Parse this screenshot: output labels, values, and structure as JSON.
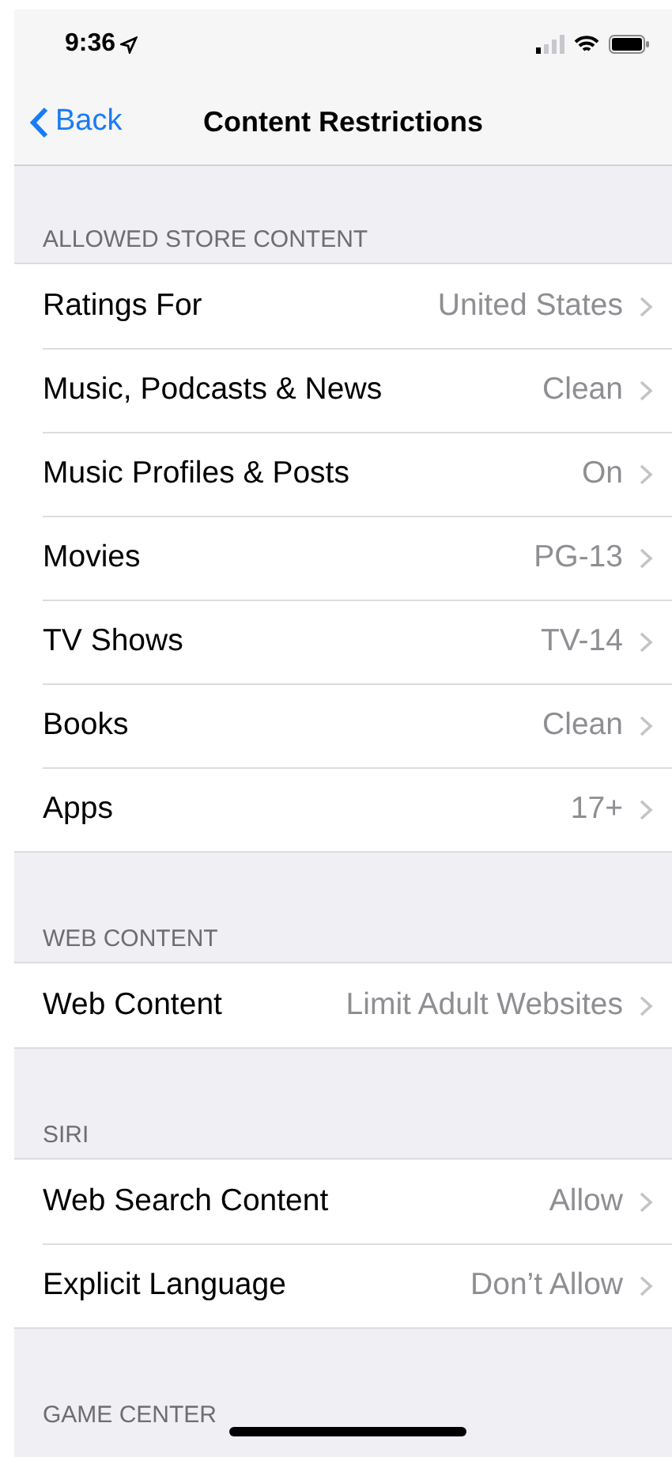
{
  "status_bar": {
    "time": "9:36"
  },
  "nav": {
    "back": "Back",
    "title": "Content Restrictions"
  },
  "sections": [
    {
      "header": "ALLOWED STORE CONTENT",
      "rows": [
        {
          "label": "Ratings For",
          "value": "United States"
        },
        {
          "label": "Music, Podcasts & News",
          "value": "Clean"
        },
        {
          "label": "Music Profiles & Posts",
          "value": "On"
        },
        {
          "label": "Movies",
          "value": "PG-13"
        },
        {
          "label": "TV Shows",
          "value": "TV-14"
        },
        {
          "label": "Books",
          "value": "Clean"
        },
        {
          "label": "Apps",
          "value": "17+"
        }
      ]
    },
    {
      "header": "WEB CONTENT",
      "rows": [
        {
          "label": "Web Content",
          "value": "Limit Adult Websites"
        }
      ]
    },
    {
      "header": "SIRI",
      "rows": [
        {
          "label": "Web Search Content",
          "value": "Allow"
        },
        {
          "label": "Explicit Language",
          "value": "Don’t Allow"
        }
      ]
    },
    {
      "header": "GAME CENTER"
    }
  ]
}
